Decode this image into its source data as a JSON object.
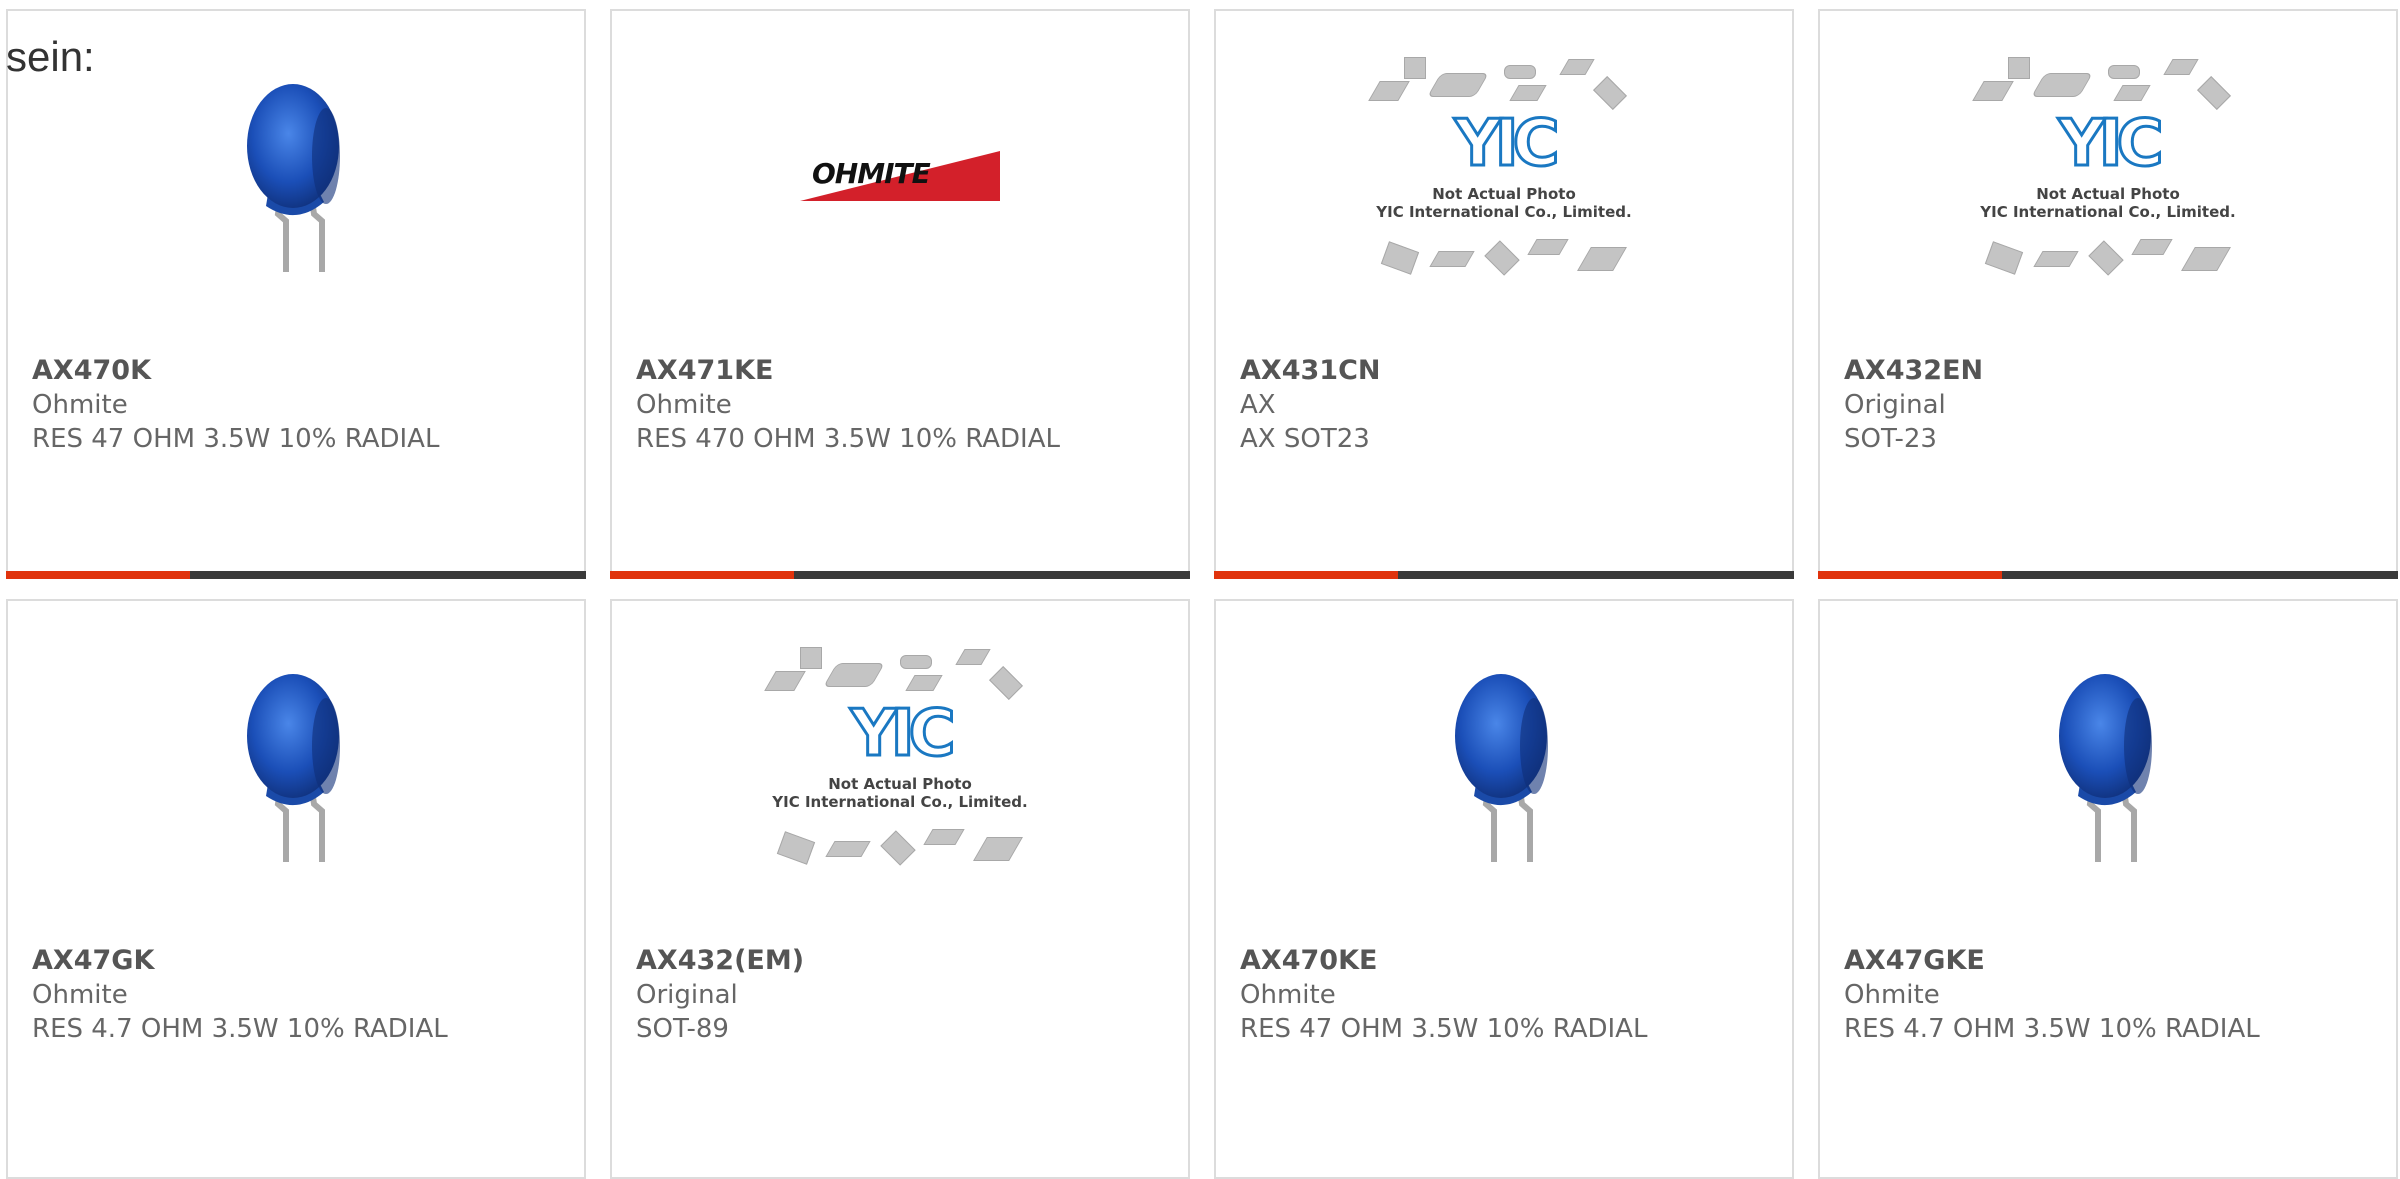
{
  "intro_text": "sein:",
  "placeholder_caption": {
    "line1": "Not Actual Photo",
    "line2": "YIC International Co., Limited."
  },
  "logo_text": {
    "yic": "YIC",
    "ohmite": "OHMITE"
  },
  "colors": {
    "accent": "#e0330d",
    "bar": "#3a3a3a",
    "border": "#dcdcdc",
    "resistor_blue": "#1b4fb8"
  },
  "products": [
    {
      "part": "AX470K",
      "mfr": "Ohmite",
      "desc": "RES 47 OHM 3.5W 10% RADIAL",
      "image": "blue-radial-resistor"
    },
    {
      "part": "AX471KE",
      "mfr": "Ohmite",
      "desc": "RES 470 OHM 3.5W 10% RADIAL",
      "image": "ohmite-logo"
    },
    {
      "part": "AX431CN",
      "mfr": "AX",
      "desc": "AX SOT23",
      "image": "yic-placeholder"
    },
    {
      "part": "AX432EN",
      "mfr": "Original",
      "desc": "SOT-23",
      "image": "yic-placeholder"
    },
    {
      "part": "AX47GK",
      "mfr": "Ohmite",
      "desc": "RES 4.7 OHM 3.5W 10% RADIAL",
      "image": "blue-radial-resistor"
    },
    {
      "part": "AX432(EM)",
      "mfr": "Original",
      "desc": "SOT-89",
      "image": "yic-placeholder"
    },
    {
      "part": "AX470KE",
      "mfr": "Ohmite",
      "desc": "RES 47 OHM 3.5W 10% RADIAL",
      "image": "blue-radial-resistor"
    },
    {
      "part": "AX47GKE",
      "mfr": "Ohmite",
      "desc": "RES 4.7 OHM 3.5W 10% RADIAL",
      "image": "blue-radial-resistor"
    }
  ]
}
